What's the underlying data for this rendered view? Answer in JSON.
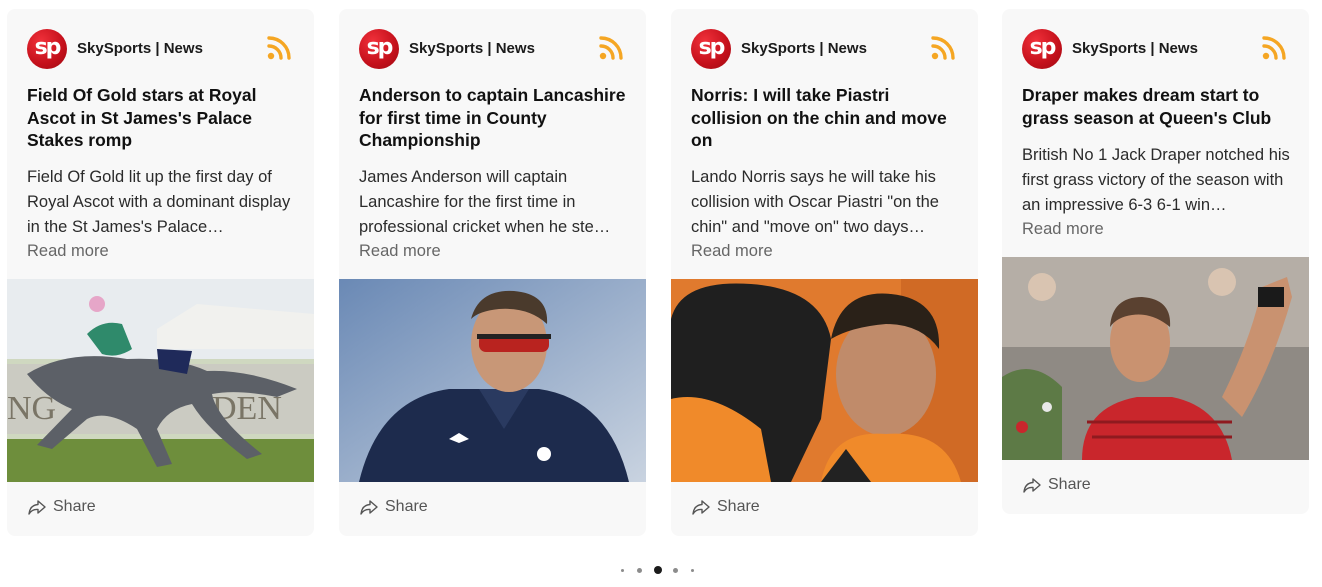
{
  "cards": [
    {
      "source": "SkySports | News",
      "logo_text": "sp",
      "title": "Field Of Gold stars at Royal Ascot in St James's Palace Stakes romp",
      "summary": "Field Of Gold lit up the first day of Royal Ascot with a dominant display in the St James's Palace…",
      "read_more": "Read more",
      "share": "Share",
      "image": "horse-racing-photo"
    },
    {
      "source": "SkySports | News",
      "logo_text": "sp",
      "title": "Anderson to captain Lancashire for first time in County Championship",
      "summary": "James Anderson will captain Lancashire for the first time in professional cricket when he ste…",
      "read_more": "Read more",
      "share": "Share",
      "image": "cricketer-photo"
    },
    {
      "source": "SkySports | News",
      "logo_text": "sp",
      "title": "Norris: I will take Piastri collision on the chin and move on",
      "summary": "Lando Norris says he will take his collision with Oscar Piastri \"on the chin\" and \"move on\" two days…",
      "read_more": "Read more",
      "share": "Share",
      "image": "f1-drivers-photo"
    },
    {
      "source": "SkySports | News",
      "logo_text": "sp",
      "title": "Draper makes dream start to grass season at Queen's Club",
      "summary": "British No 1 Jack Draper notched his first grass victory of the season with an impressive 6-3 6-1 win…",
      "read_more": "Read more",
      "share": "Share",
      "image": "tennis-player-photo"
    }
  ],
  "pagination": {
    "count": 5,
    "active_index": 2
  },
  "colors": {
    "card_bg": "#f8f8f8",
    "rss": "#f5a623",
    "logo": "#d0141f"
  }
}
